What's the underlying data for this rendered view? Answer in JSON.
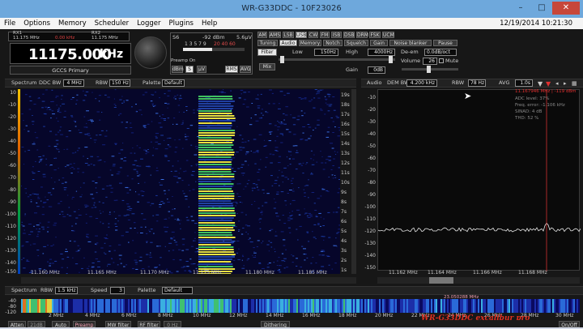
{
  "window": {
    "title": "WR-G33DDC - 10F23026"
  },
  "menu": {
    "items": [
      "File",
      "Options",
      "Memory",
      "Scheduler",
      "Logger",
      "Plugins",
      "Help"
    ],
    "datetime": "12/19/2014 10:21:30"
  },
  "receiver": {
    "rx1_label": "RX1",
    "rx1_freq": "11.175 MHz",
    "rx1_status": "0.00 kHz",
    "rx2_label": "RX2",
    "rx2_freq": "11.175 MHz",
    "freq_main": "11175.000",
    "freq_unit": "kHz",
    "station": "GCCS Primary"
  },
  "smeter": {
    "label": "S6",
    "dbm": "-92 dBm",
    "uv": "5.6µV",
    "scale": "1 3 5 7 9",
    "scale_over": "20  40  60",
    "preamp": "Preamp On",
    "dbm_btn": "dBm",
    "s_btn": "S",
    "uv_btn": "µV",
    "rms_btn": "RMS",
    "avg_btn": "AVG"
  },
  "modes": [
    "AM",
    "AMS",
    "LSB",
    "USB",
    "CW",
    "FM",
    "ISB",
    "DSB",
    "DRM",
    "FSK",
    "UCM"
  ],
  "active_mode": "USB",
  "tabs": [
    "Tuning",
    "Audio",
    "Memory",
    "Notch",
    "Squelch",
    "Gain",
    "Noise blanker",
    "Pause"
  ],
  "active_tab": "Audio",
  "audio": {
    "filter_label": "Filter",
    "low_label": "Low",
    "low_value": "150Hz",
    "high_label": "High",
    "high_value": "4000Hz",
    "deem_label": "De-em",
    "deem_value": "0.0dB/oct",
    "mix_label": "Mix",
    "volume_label": "Volume",
    "volume_value": "26",
    "mute_label": "Mute",
    "gain_label": "Gain",
    "gain_value": "0dB"
  },
  "spectrum_left": {
    "title": "Spectrum",
    "ddc_bw_label": "DDC BW",
    "ddc_bw_value": "4 MHz",
    "rbw_label": "RBW",
    "rbw_value": "150 Hz",
    "palette_label": "Palette",
    "palette_value": "Default",
    "y_ticks": [
      "-10",
      "-20",
      "-30",
      "-40",
      "-50",
      "-60",
      "-70",
      "-80",
      "-90",
      "-100",
      "-110",
      "-120",
      "-130",
      "-140",
      "-150"
    ],
    "y0_label": "10",
    "t_ticks": [
      "19s",
      "18s",
      "17s",
      "16s",
      "15s",
      "14s",
      "13s",
      "12s",
      "11s",
      "10s",
      "9s",
      "8s",
      "7s",
      "6s",
      "5s",
      "4s",
      "3s",
      "2s",
      "1s"
    ],
    "x_ticks": [
      "11.160 MHz",
      "11.165 MHz",
      "11.170 MHz",
      "11.175 MHz",
      "11.180 MHz",
      "11.185 MHz"
    ]
  },
  "spectrum_right": {
    "title": "Audio",
    "dem_bw_label": "DEM BW",
    "dem_bw_value": "4.200 kHz",
    "rbw_label": "RBW",
    "rbw_value": "78 Hz",
    "avg_label": "AVG",
    "avg_value": "1.0s",
    "marker": "11.167946 MHz | -119 dBm",
    "info": [
      "ADC level: 37%",
      "Freq. error: -1.106 kHz",
      "SINAD: 4 dB",
      "THD: 52 %"
    ],
    "y_ticks": [
      "-10",
      "-20",
      "-30",
      "-40",
      "-50",
      "-60",
      "-70",
      "-80",
      "-90",
      "-100",
      "-110",
      "-120",
      "-130",
      "-140",
      "-150"
    ],
    "x_ticks": [
      "11.162 MHz",
      "11.164 MHz",
      "11.166 MHz",
      "11.168 MHz"
    ]
  },
  "bottom_spectrum": {
    "title": "Spectrum",
    "rbw_label": "RBW",
    "rbw_value": "1.5 kHz",
    "speed_label": "Speed",
    "speed_value": "3",
    "palette_label": "Palette",
    "palette_value": "Default",
    "y_ticks": [
      "-40",
      "-80",
      "-120"
    ],
    "x_ticks": [
      "2 MHz",
      "4 MHz",
      "6 MHz",
      "8 MHz",
      "10 MHz",
      "12 MHz",
      "14 MHz",
      "16 MHz",
      "18 MHz",
      "20 MHz",
      "22 MHz",
      "24 MHz",
      "26 MHz",
      "28 MHz",
      "30 MHz"
    ],
    "marker": "23.050288 MHz"
  },
  "statusbar": {
    "items": [
      "Atten",
      "21dB",
      "Auto",
      "Preamp",
      "MW filter",
      "RF filter",
      "0 Hz",
      "Dithering",
      "On/Off"
    ]
  },
  "watermark": "WR-G33DDC  excalibur pro"
}
